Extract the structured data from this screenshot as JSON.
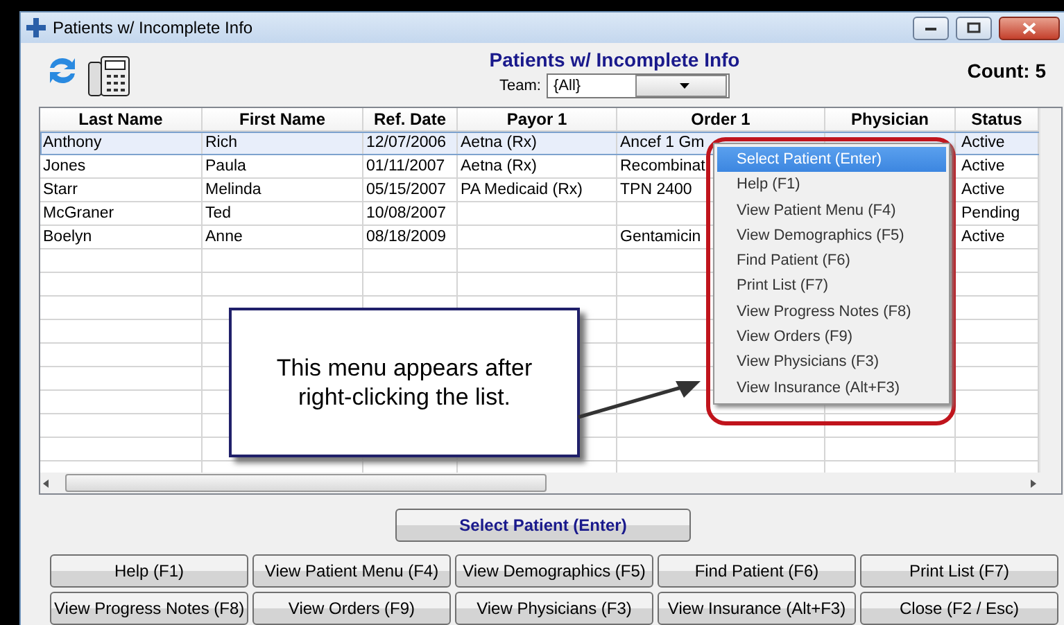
{
  "window": {
    "title": "Patients w/ Incomplete Info"
  },
  "header": {
    "title": "Patients w/ Incomplete Info",
    "team_label": "Team:",
    "team_value": "{All}",
    "count": "Count: 5"
  },
  "table": {
    "columns": [
      "Last Name",
      "First Name",
      "Ref. Date",
      "Payor 1",
      "Order 1",
      "Physician",
      "Status"
    ],
    "rows": [
      {
        "cells": [
          "Anthony",
          "Rich",
          "12/07/2006",
          "Aetna (Rx)",
          "Ancef 1 Gm",
          "",
          "Active"
        ],
        "selected": true
      },
      {
        "cells": [
          "Jones",
          "Paula",
          "01/11/2007",
          "Aetna (Rx)",
          "Recombinat",
          "",
          "Active"
        ],
        "selected": false
      },
      {
        "cells": [
          "Starr",
          "Melinda",
          "05/15/2007",
          "PA Medicaid (Rx)",
          "TPN 2400",
          "",
          "Active"
        ],
        "selected": false
      },
      {
        "cells": [
          "McGraner",
          "Ted",
          "10/08/2007",
          "",
          "",
          "",
          "Pending"
        ],
        "selected": false
      },
      {
        "cells": [
          "Boelyn",
          "Anne",
          "08/18/2009",
          "",
          "Gentamicin",
          "",
          "Active"
        ],
        "selected": false
      }
    ]
  },
  "context_menu": [
    {
      "label": "Select Patient (Enter)",
      "selected": true
    },
    {
      "label": "Help (F1)",
      "selected": false
    },
    {
      "label": "View Patient Menu (F4)",
      "selected": false
    },
    {
      "label": "View Demographics (F5)",
      "selected": false
    },
    {
      "label": "Find Patient (F6)",
      "selected": false
    },
    {
      "label": "Print List (F7)",
      "selected": false
    },
    {
      "label": "View Progress Notes (F8)",
      "selected": false
    },
    {
      "label": "View Orders (F9)",
      "selected": false
    },
    {
      "label": "View Physicians (F3)",
      "selected": false
    },
    {
      "label": "View Insurance (Alt+F3)",
      "selected": false
    }
  ],
  "callout": "This menu appears after right-clicking the list.",
  "primary_button": "Select Patient (Enter)",
  "buttons": [
    "Help (F1)",
    "View Patient Menu (F4)",
    "View Demographics (F5)",
    "Find Patient (F6)",
    "Print List (F7)",
    "View Progress Notes (F8)",
    "View Orders (F9)",
    "View Physicians (F3)",
    "View Insurance (Alt+F3)",
    "Close (F2 / Esc)"
  ]
}
